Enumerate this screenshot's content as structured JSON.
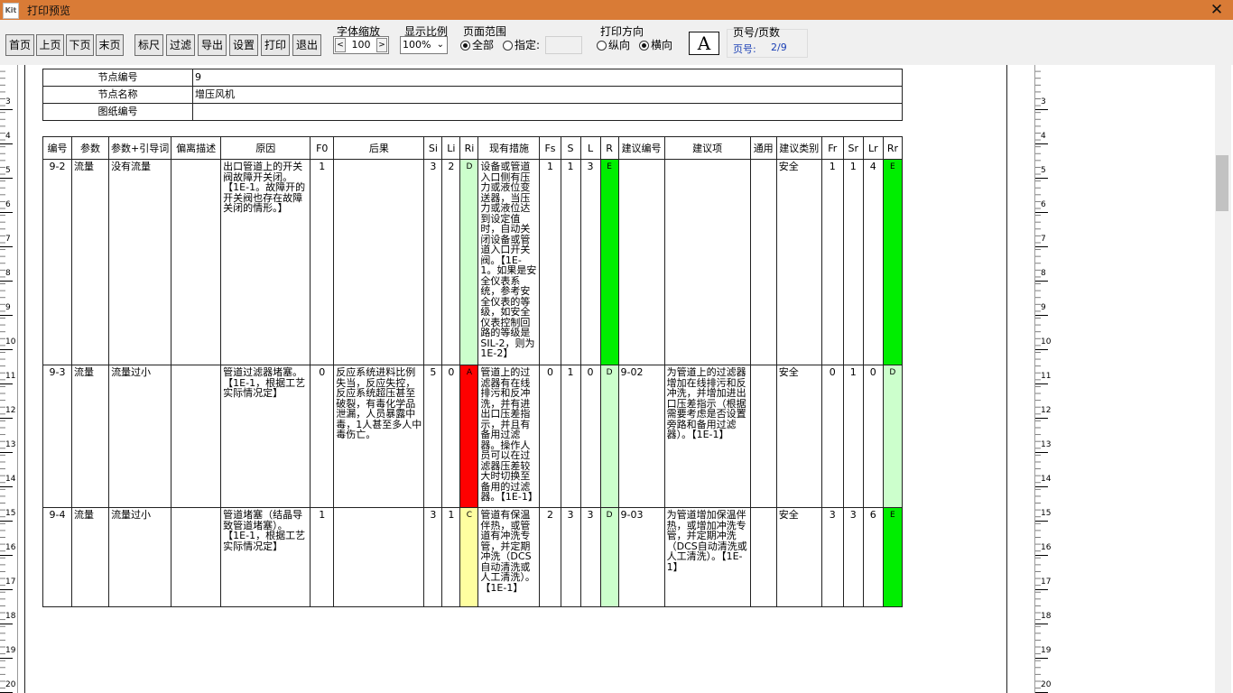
{
  "window": {
    "title": "打印预览",
    "app_icon_text": "Kit",
    "close_glyph": "✕"
  },
  "toolbar": {
    "buttons": [
      "首页",
      "上页",
      "下页",
      "末页",
      "标尺",
      "过滤",
      "导出",
      "设置",
      "打印",
      "退出"
    ],
    "font_zoom": {
      "label": "字体缩放",
      "value": "100",
      "dec": "<",
      "inc": ">"
    },
    "display_ratio": {
      "label": "显示比例",
      "value": "100%"
    },
    "page_range": {
      "label": "页面范围",
      "all": "全部",
      "specify": "指定:",
      "selected": "all"
    },
    "orientation": {
      "label": "打印方向",
      "portrait": "纵向",
      "landscape": "横向",
      "selected": "landscape"
    },
    "font_button": "A",
    "page_info": {
      "label": "页号/页数",
      "value_label": "页号:",
      "value": "2/9"
    }
  },
  "ruler": {
    "numbers": [
      "3",
      "4",
      "5",
      "6",
      "7",
      "8",
      "9",
      "10",
      "11",
      "12",
      "13",
      "14",
      "15",
      "16",
      "17",
      "18",
      "19",
      "20"
    ]
  },
  "node": {
    "rows": [
      {
        "label": "节点编号",
        "value": "9"
      },
      {
        "label": "节点名称",
        "value": "增压风机"
      },
      {
        "label": "图纸编号",
        "value": ""
      }
    ]
  },
  "table": {
    "headers": [
      "编号",
      "参数",
      "参数+引导词",
      "偏离描述",
      "原因",
      "F0",
      "后果",
      "Si",
      "Li",
      "Ri",
      "现有措施",
      "Fs",
      "S",
      "L",
      "R",
      "建议编号",
      "建议项",
      "通用",
      "建议类别",
      "Fr",
      "Sr",
      "Lr",
      "Rr"
    ],
    "rows": [
      {
        "id": "9-2",
        "param": "流量",
        "guide": "没有流量",
        "deviation": "",
        "cause": "出口管道上的开关阀故障开关闭。【1E-1。故障开的开关阀也存在故障关闭的情形。】",
        "f0": "1",
        "consequence": "",
        "si": "3",
        "li": "2",
        "ri": "D",
        "measures": "设备或管道入口侧有压力或液位变送器，当压力或液位达到设定值时，自动关闭设备或管道入口开关阀。【1E-1。如果是安全仪表系统，参考安全仪表的等级，如安全仪表控制回路的等级是SIL-2，则为1E-2】",
        "fs": "1",
        "s": "1",
        "l": "3",
        "r": "E",
        "sug_id": "",
        "sug": "",
        "common": "",
        "category": "安全",
        "fr": "1",
        "sr": "1",
        "lr": "4",
        "rr": "E"
      },
      {
        "id": "9-3",
        "param": "流量",
        "guide": "流量过小",
        "deviation": "",
        "cause": "管道过滤器堵塞。【1E-1，根据工艺实际情况定】",
        "f0": "0",
        "consequence": "反应系统进料比例失当，反应失控，反应系统超压甚至破裂，有毒化学品泄漏，人员暴露中毒，1人甚至多人中毒伤亡。",
        "si": "5",
        "li": "0",
        "ri": "A",
        "measures": "管道上的过滤器有在线排污和反冲洗，并有进出口压差指示，并且有备用过滤器。操作人员可以在过滤器压差较大时切换至备用的过滤器。【1E-1】",
        "fs": "0",
        "s": "1",
        "l": "0",
        "r": "D",
        "sug_id": "9-02",
        "sug": "为管道上的过滤器增加在线排污和反冲洗，并增加进出口压差指示（根据需要考虑是否设置旁路和备用过滤器）。【1E-1】",
        "common": "",
        "category": "安全",
        "fr": "0",
        "sr": "1",
        "lr": "0",
        "rr": "D"
      },
      {
        "id": "9-4",
        "param": "流量",
        "guide": "流量过小",
        "deviation": "",
        "cause": "管道堵塞（结晶导致管道堵塞）。【1E-1，根据工艺实际情况定】",
        "f0": "1",
        "consequence": "",
        "si": "3",
        "li": "1",
        "ri": "C",
        "measures": "管道有保温伴热，或管道有冲洗专管，并定期冲洗（DCS自动清洗或人工清洗）。【1E-1】",
        "fs": "2",
        "s": "3",
        "l": "3",
        "r": "D",
        "sug_id": "9-03",
        "sug": "为管道增加保温伴热，或增加冲洗专管，并定期冲洗（DCS自动清洗或人工清洗）。【1E-1】",
        "common": "",
        "category": "安全",
        "fr": "3",
        "sr": "3",
        "lr": "6",
        "rr": "E"
      }
    ],
    "risk_colors": {
      "A": "#ff0000",
      "C": "#ffffa0",
      "D": "#ccffcc",
      "E": "#00ee00"
    }
  }
}
